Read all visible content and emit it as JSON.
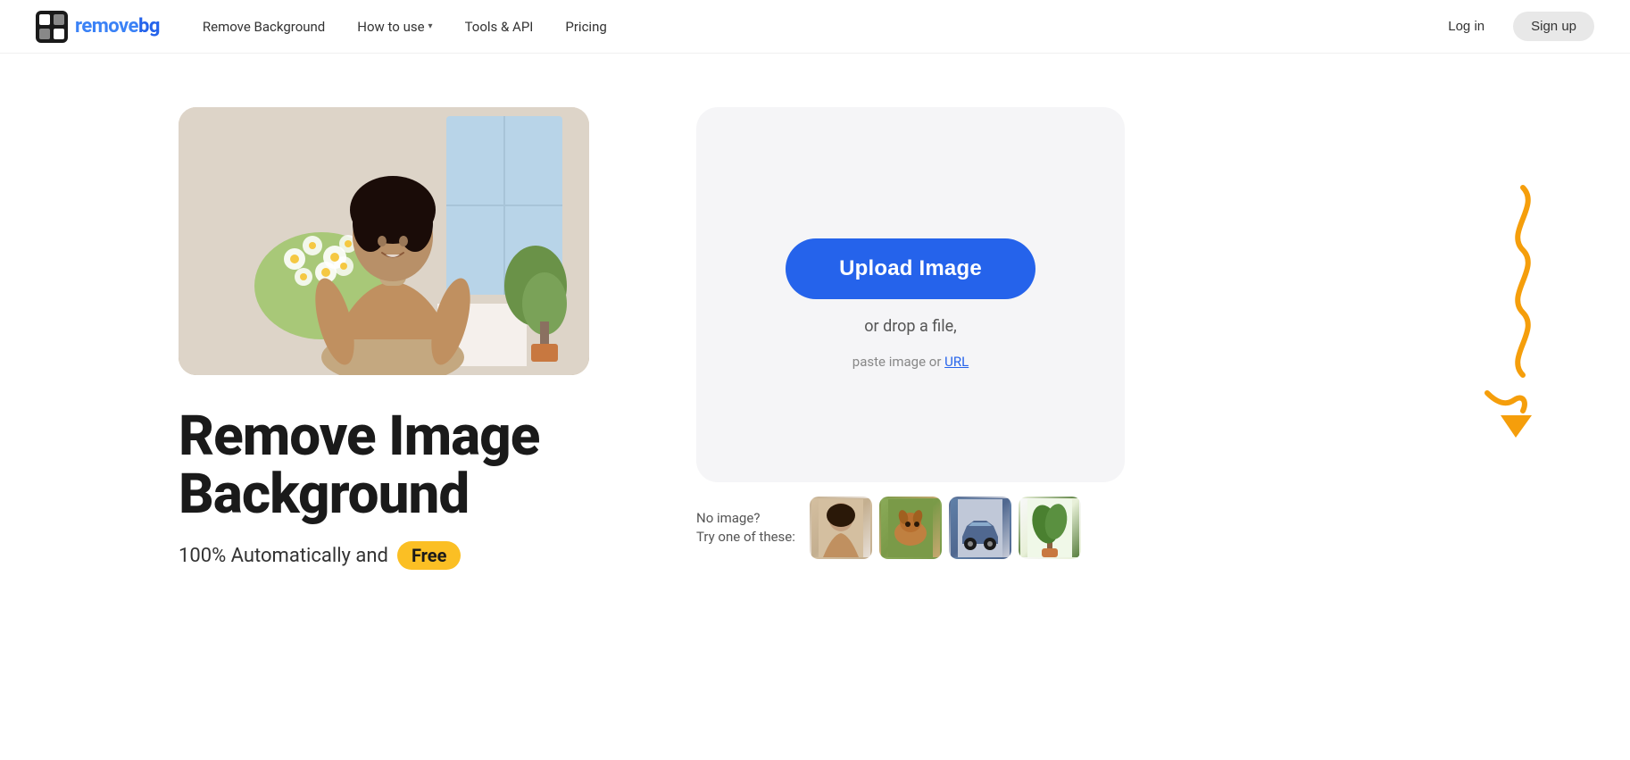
{
  "brand": {
    "name_part1": "remove",
    "name_part2": "bg",
    "logo_alt": "remove.bg logo"
  },
  "nav": {
    "link_remove_bg": "Remove Background",
    "link_how_to_use": "How to use",
    "link_tools_api": "Tools & API",
    "link_pricing": "Pricing",
    "btn_login": "Log in",
    "btn_signup": "Sign up"
  },
  "hero": {
    "heading_line1": "Remove Image",
    "heading_line2": "Background",
    "tagline_prefix": "100% Automatically and",
    "free_badge": "Free"
  },
  "upload": {
    "btn_label": "Upload Image",
    "drop_text": "or drop a file,",
    "paste_text": "paste image or",
    "url_link_text": "URL"
  },
  "samples": {
    "label_line1": "No image?",
    "label_line2": "Try one of these:",
    "thumbs": [
      {
        "id": "person",
        "alt": "Person sample"
      },
      {
        "id": "dog",
        "alt": "Dog sample"
      },
      {
        "id": "car",
        "alt": "Car sample"
      },
      {
        "id": "plant",
        "alt": "Plant sample"
      }
    ]
  },
  "colors": {
    "accent_blue": "#2563eb",
    "accent_yellow": "#fbbf24",
    "text_dark": "#1a1a1a",
    "text_mid": "#555555",
    "bg_card": "#f5f5f7"
  }
}
